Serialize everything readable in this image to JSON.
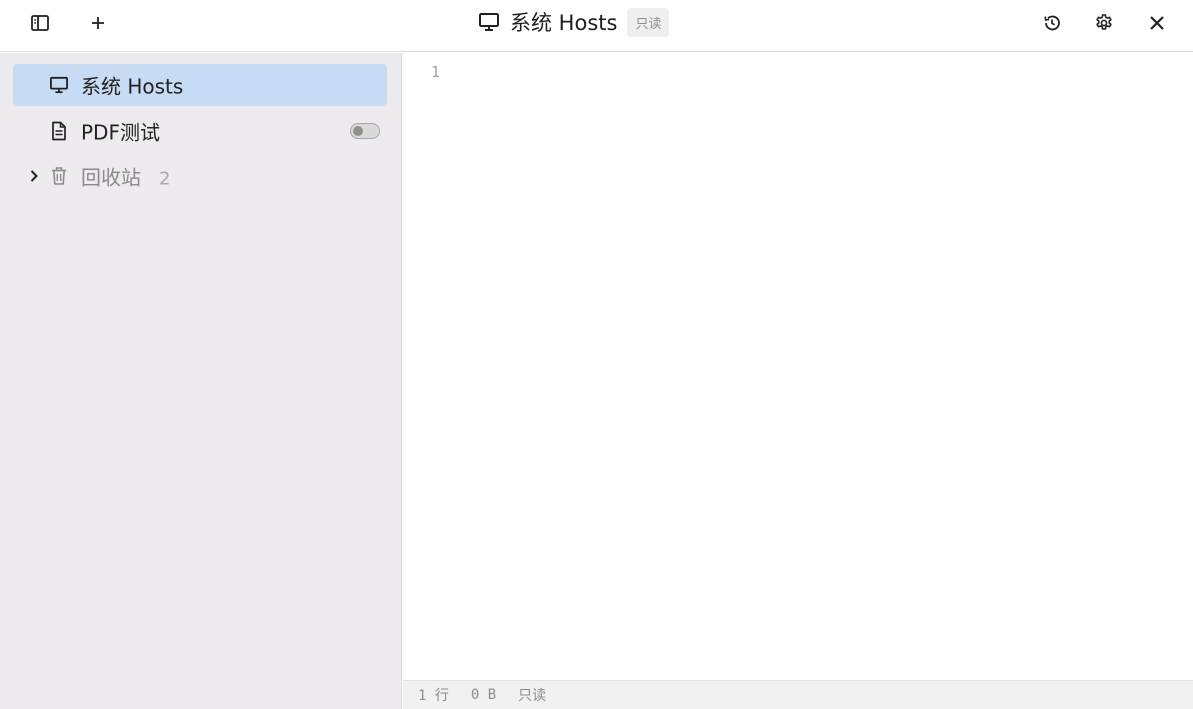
{
  "topbar": {
    "toggle_sidebar_icon": "sidebar-layout-icon",
    "add_icon": "plus-icon",
    "title_icon": "monitor-icon",
    "title": "系统 Hosts",
    "readonly_badge": "只读",
    "history_icon": "history-icon",
    "settings_icon": "gear-icon",
    "close_icon": "close-icon"
  },
  "sidebar": {
    "items": [
      {
        "icon": "monitor-icon",
        "label": "系统 Hosts",
        "active": true
      },
      {
        "icon": "document-icon",
        "label": "PDF测试",
        "toggle_on": false
      },
      {
        "icon": "trash-icon",
        "label": "回收站",
        "count": "2",
        "expanded": false
      }
    ]
  },
  "editor": {
    "line_numbers": [
      "1"
    ],
    "content": ""
  },
  "statusbar": {
    "lines": "1 行",
    "size": "0 B",
    "mode": "只读"
  },
  "colors": {
    "sidebar_bg": "#eeebf0",
    "active_item_bg": "#c7dcf4",
    "statusbar_bg": "#f1f1f1"
  }
}
